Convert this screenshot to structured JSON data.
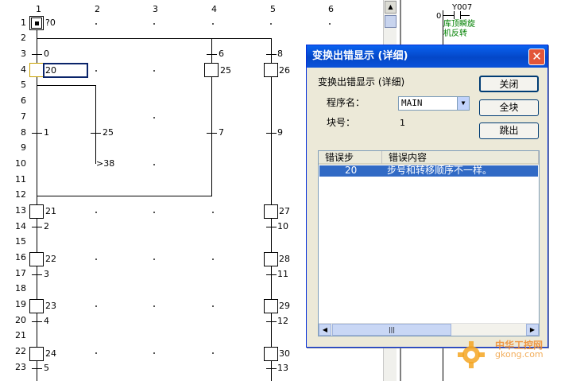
{
  "sfc": {
    "columns": [
      "1",
      "2",
      "3",
      "4",
      "5",
      "6"
    ],
    "rows": [
      "1",
      "2",
      "3",
      "4",
      "5",
      "6",
      "7",
      "8",
      "9",
      "10",
      "11",
      "12",
      "13",
      "14",
      "15",
      "16",
      "17",
      "18",
      "19",
      "20",
      "21",
      "22",
      "23"
    ],
    "initial_step": "?0",
    "labels": {
      "t_0": "0",
      "s_20": "20",
      "t_1": "1",
      "t_25": "25",
      "jump_38": "38",
      "t_6": "6",
      "s_25": "25",
      "t_7": "7",
      "t_8": "8",
      "s_26": "26",
      "t_9": "9",
      "s_21": "21",
      "t_2": "2",
      "s_22": "22",
      "t_3": "3",
      "s_23": "23",
      "t_4": "4",
      "s_24": "24",
      "t_5": "5",
      "s_27": "27",
      "t_10": "10",
      "s_28": "28",
      "t_11": "11",
      "s_29": "29",
      "t_12": "12",
      "s_30": "30",
      "t_13": "13"
    }
  },
  "ladder": {
    "contact_label": "Y007",
    "row_num": "0",
    "comment_line1": "库顶瞬旋",
    "comment_line2": "机反转"
  },
  "dialog": {
    "title": "变换出错显示 (详细)",
    "close_glyph": "✕",
    "heading": "变换出错显示 (详细)",
    "program_label": "程序名：",
    "program_value": "MAIN",
    "block_label": "块号：",
    "block_value": "1",
    "buttons": {
      "close": "关闭",
      "all_blocks": "全块",
      "jump": "跳出"
    },
    "list": {
      "headers": [
        "错误步",
        "错误内容"
      ],
      "rows": [
        {
          "step": "20",
          "message": "步号和转移顺序不一样。"
        }
      ]
    }
  },
  "watermark": {
    "cn": "中华工控网",
    "en": "gkong.com"
  },
  "colors": {
    "selected_row": "#316ac5",
    "titlebar": "#0a52da",
    "dialog_bg": "#ece9d8"
  }
}
